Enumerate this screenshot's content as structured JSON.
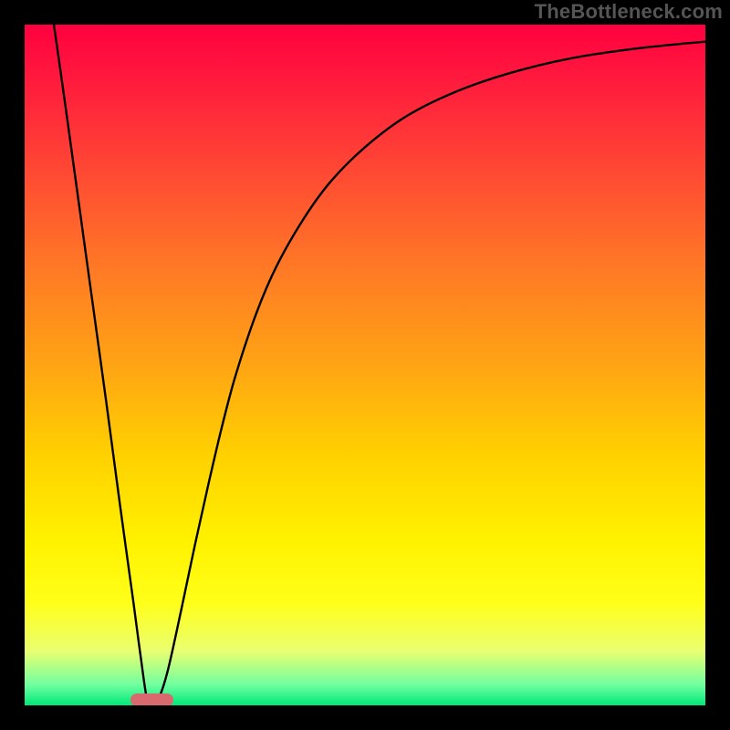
{
  "watermark": "TheBottleneck.com",
  "marker": {
    "x_pct": 15.5,
    "y_pct": 99.2,
    "w_pct": 6.4,
    "h_pct": 2.0
  },
  "chart_data": {
    "type": "line",
    "title": "",
    "xlabel": "",
    "ylabel": "",
    "xlim": [
      0,
      100
    ],
    "ylim": [
      0,
      100
    ],
    "curve_points": [
      {
        "x": 4.3,
        "y": 100.0
      },
      {
        "x": 6.0,
        "y": 88.0
      },
      {
        "x": 8.0,
        "y": 73.5
      },
      {
        "x": 10.0,
        "y": 59.0
      },
      {
        "x": 12.0,
        "y": 44.5
      },
      {
        "x": 14.0,
        "y": 29.5
      },
      {
        "x": 16.0,
        "y": 15.0
      },
      {
        "x": 17.0,
        "y": 7.5
      },
      {
        "x": 18.0,
        "y": 0.8
      },
      {
        "x": 18.8,
        "y": 0.5
      },
      {
        "x": 19.6,
        "y": 0.8
      },
      {
        "x": 21.0,
        "y": 5.0
      },
      {
        "x": 23.0,
        "y": 14.0
      },
      {
        "x": 25.0,
        "y": 23.5
      },
      {
        "x": 27.0,
        "y": 32.5
      },
      {
        "x": 29.0,
        "y": 41.0
      },
      {
        "x": 31.0,
        "y": 48.5
      },
      {
        "x": 34.0,
        "y": 57.5
      },
      {
        "x": 37.0,
        "y": 64.5
      },
      {
        "x": 41.0,
        "y": 71.5
      },
      {
        "x": 45.0,
        "y": 77.0
      },
      {
        "x": 50.0,
        "y": 82.0
      },
      {
        "x": 56.0,
        "y": 86.5
      },
      {
        "x": 63.0,
        "y": 90.0
      },
      {
        "x": 71.0,
        "y": 92.8
      },
      {
        "x": 80.0,
        "y": 95.0
      },
      {
        "x": 90.0,
        "y": 96.5
      },
      {
        "x": 100.0,
        "y": 97.5
      }
    ],
    "gradient_stops": [
      {
        "pos": 0.0,
        "color": "#ff003f"
      },
      {
        "pos": 0.5,
        "color": "#ffa414"
      },
      {
        "pos": 0.85,
        "color": "#ffff1a"
      },
      {
        "pos": 1.0,
        "color": "#00e878"
      }
    ],
    "marker": {
      "x": 16.0,
      "width": 6.0
    }
  }
}
